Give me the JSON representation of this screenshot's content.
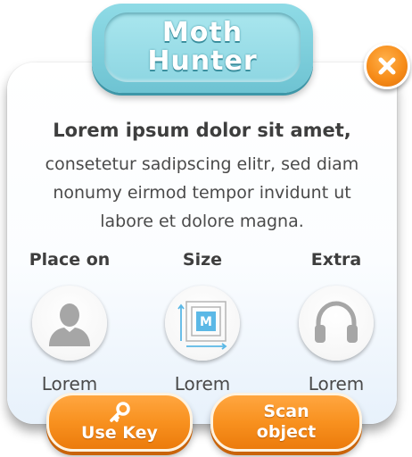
{
  "title": {
    "line1": "Moth",
    "line2": "Hunter"
  },
  "close_icon": "close-x-icon",
  "content": {
    "heading": "Lorem ipsum dolor sit amet,",
    "lines": [
      "consetetur sadipscing elitr, sed diam",
      "nonumy eirmod tempor invidunt ut",
      "labore et dolore magna."
    ]
  },
  "options": [
    {
      "label": "Place on",
      "caption": "Lorem",
      "icon": "person-icon"
    },
    {
      "label": "Size",
      "caption": "Lorem",
      "icon": "size-m-icon",
      "badge": "M"
    },
    {
      "label": "Extra",
      "caption": "Lorem",
      "icon": "headphones-icon"
    }
  ],
  "buttons": {
    "use_key": {
      "label": "Use Key",
      "icon": "key-icon"
    },
    "scan": {
      "line1": "Scan",
      "line2": "object"
    }
  },
  "colors": {
    "accent_orange": "#f8911f",
    "title_teal": "#8ed6e2",
    "icon_gray": "#a6a6a6",
    "size_blue": "#5bb8e6"
  }
}
